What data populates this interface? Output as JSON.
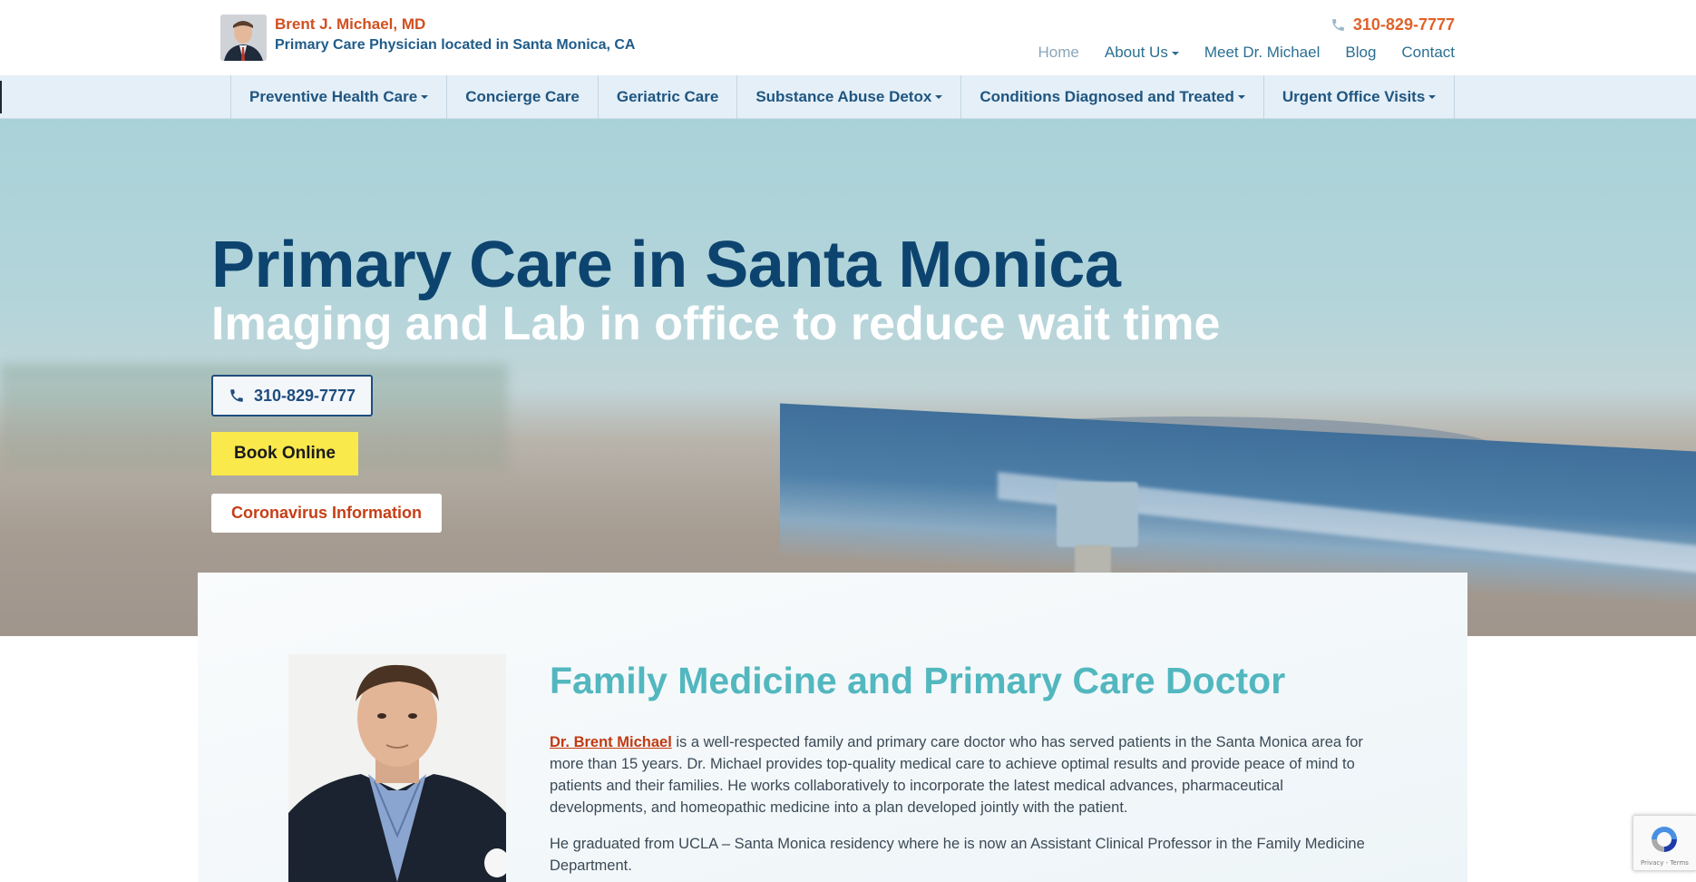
{
  "header": {
    "brand_name": "Brent J. Michael, MD",
    "brand_subtitle": "Primary Care Physician located in Santa Monica, CA",
    "phone": "310-829-7777",
    "nav": [
      {
        "label": "Home"
      },
      {
        "label": "About Us"
      },
      {
        "label": "Meet Dr. Michael"
      },
      {
        "label": "Blog"
      },
      {
        "label": "Contact"
      }
    ]
  },
  "service_nav": [
    {
      "label": "Preventive Health Care"
    },
    {
      "label": "Concierge Care"
    },
    {
      "label": "Geriatric Care"
    },
    {
      "label": "Substance Abuse Detox"
    },
    {
      "label": "Conditions Diagnosed and Treated"
    },
    {
      "label": "Urgent Office Visits"
    }
  ],
  "hero": {
    "title": "Primary Care in Santa Monica",
    "subtitle": "Imaging and Lab in office to reduce wait time",
    "phone_button": "310-829-7777",
    "book_button": "Book Online",
    "covid_button": "Coronavirus Information"
  },
  "about": {
    "title": "Family Medicine and Primary Care Doctor",
    "link_text": "Dr. Brent Michael",
    "paragraph1_rest": " is a well-respected family and primary care doctor who has served patients in the Santa Monica area for more than 15 years. Dr. Michael provides top-quality medical care to achieve optimal results and provide peace of mind to patients and their families. He works collaboratively to incorporate the latest medical advances, pharmaceutical developments, and homeopathic medicine into a plan developed jointly with the patient.",
    "paragraph2": "He graduated from UCLA – Santa Monica residency where he is now an Assistant Clinical Professor in the Family Medicine Department."
  },
  "recaptcha": {
    "footer_text": "Privacy - Terms"
  },
  "colors": {
    "brand_orange": "#d24f1f",
    "brand_blue": "#1f5c8a",
    "hero_title": "#0d446f",
    "teal_heading": "#52b7bf",
    "book_yellow": "#f9e94b"
  }
}
